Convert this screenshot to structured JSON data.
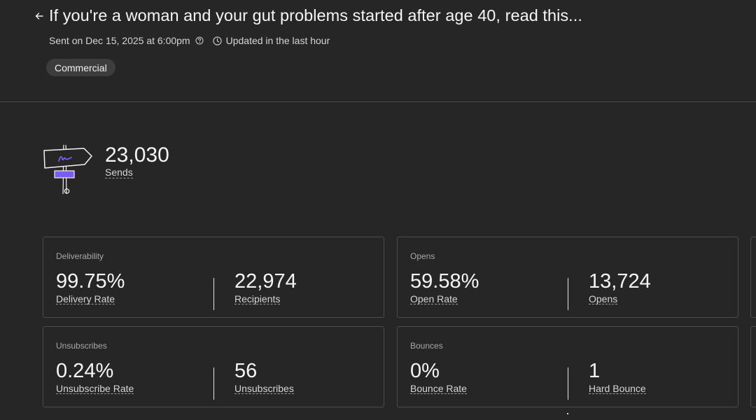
{
  "header": {
    "title": "If you're a woman and your gut problems started after age 40, read this...",
    "sent_text": "Sent on Dec 15, 2025 at 6:00pm",
    "updated_text": "Updated in the last hour",
    "badge": "Commercial"
  },
  "sends": {
    "value": "23,030",
    "label": "Sends"
  },
  "cards": {
    "deliverability": {
      "title": "Deliverability",
      "primary_value": "99.75%",
      "primary_label": "Delivery Rate",
      "secondary_value": "22,974",
      "secondary_label": "Recipients"
    },
    "opens": {
      "title": "Opens",
      "primary_value": "59.58%",
      "primary_label": "Open Rate",
      "secondary_value": "13,724",
      "secondary_label": "Opens"
    },
    "unsubscribes": {
      "title": "Unsubscribes",
      "primary_value": "0.24%",
      "primary_label": "Unsubscribe Rate",
      "secondary_value": "56",
      "secondary_label": "Unsubscribes"
    },
    "bounces": {
      "title": "Bounces",
      "primary_value": "0%",
      "primary_label": "Bounce Rate",
      "secondary_value": "1",
      "secondary_label": "Hard Bounce"
    }
  },
  "icons": {
    "back": "arrow-left-icon",
    "help": "question-circle-icon",
    "clock": "clock-icon",
    "illustration": "signpost-icon"
  },
  "colors": {
    "background": "#262626",
    "accent_purple": "#7b5cf0",
    "text": "#f5f5f5",
    "muted": "#a8a8a8",
    "border": "#4c4c4c"
  }
}
